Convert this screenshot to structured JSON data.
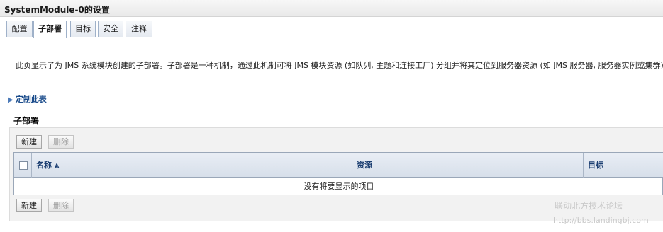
{
  "window": {
    "title": "SystemModule-0的设置"
  },
  "tabs": [
    {
      "label": "配置"
    },
    {
      "label": "子部署"
    },
    {
      "label": "目标"
    },
    {
      "label": "安全"
    },
    {
      "label": "注释"
    }
  ],
  "description": "此页显示了为 JMS 系统模块创建的子部署。子部署是一种机制，通过此机制可将 JMS 模块资源 (如队列, 主题和连接工厂) 分组并将其定位到服务器资源 (如 JMS 服务器, 服务器实例或集群)。",
  "customize_link": "定制此表",
  "section": {
    "title": "子部署"
  },
  "toolbar": {
    "new_label": "新建",
    "delete_label": "删除"
  },
  "table": {
    "columns": [
      {
        "label": "名称 ⩓"
      },
      {
        "label": "资源"
      },
      {
        "label": "目标"
      }
    ],
    "empty_message": "没有将要显示的项目"
  },
  "watermark": {
    "text": "联动北方技术论坛",
    "url": "http://bbs.landingbj.com"
  }
}
